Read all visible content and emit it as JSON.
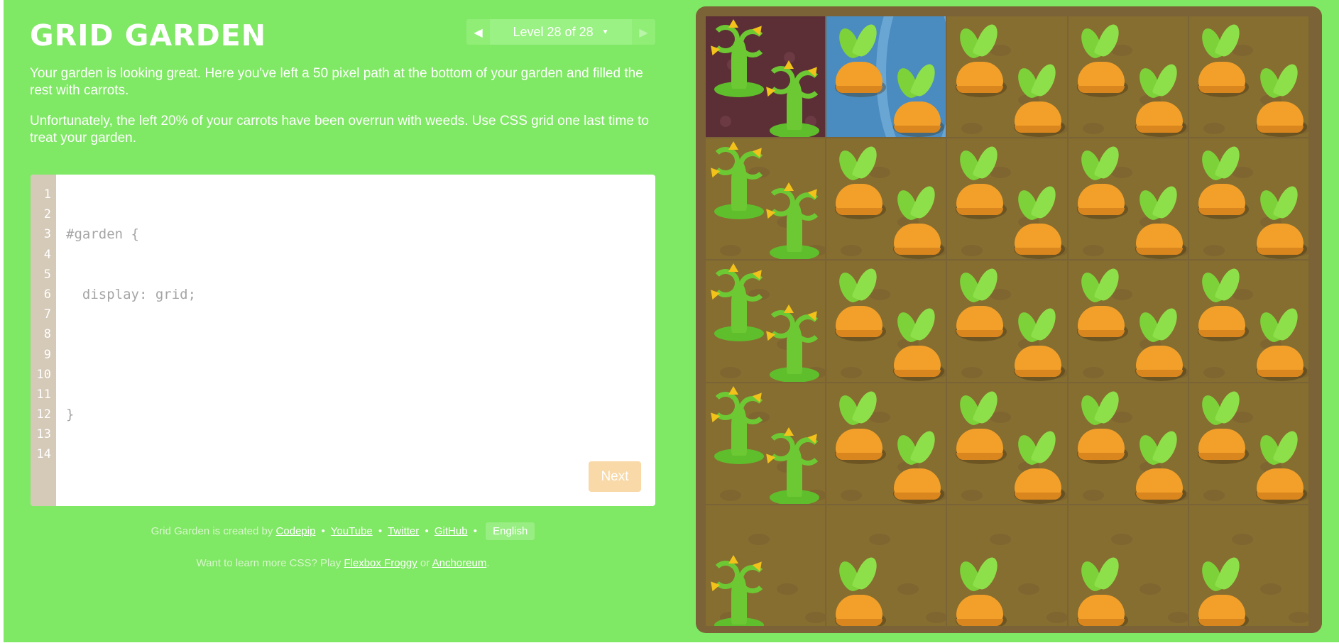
{
  "app": {
    "title": "GRID GARDEN"
  },
  "level_nav": {
    "prev_icon": "triangle-left-icon",
    "label": "Level 28 of 28",
    "caret_icon": "caret-down-icon",
    "next_icon": "triangle-right-icon"
  },
  "instructions": [
    "Your garden is looking great. Here you've left a 50 pixel path at the bottom of your garden and filled the rest with carrots.",
    "Unfortunately, the left 20% of your carrots have been overrun with weeds. Use CSS grid one last time to treat your garden."
  ],
  "editor": {
    "line_numbers": [
      "1",
      "2",
      "3",
      "4",
      "5",
      "6",
      "7",
      "8",
      "9",
      "10",
      "11",
      "12",
      "13",
      "14"
    ],
    "code_lines": [
      "#garden {",
      "  display: grid;",
      "",
      "}"
    ],
    "input_value": "",
    "next_label": "Next"
  },
  "footer": {
    "created_by": "Grid Garden is created by",
    "links": [
      "Codepip",
      "YouTube",
      "Twitter",
      "GitHub"
    ],
    "separator": "•",
    "language": "English",
    "learn_more_prefix": "Want to learn more CSS? Play",
    "learn_more_link1": "Flexbox Froggy",
    "learn_more_or": "or",
    "learn_more_link2": "Anchoreum",
    "learn_more_suffix": "."
  },
  "colors": {
    "background": "#7fe864",
    "board": "#7b6337",
    "soil": "#866d30",
    "water": "#4a8cbf",
    "weed_soil": "#5b2f35",
    "carrot": "#f2a02a",
    "leaf": "#7dd23a",
    "next_button": "#f8d9a7"
  },
  "garden": {
    "icons": [
      "carrot-icon",
      "weed-icon",
      "water-icon"
    ]
  }
}
